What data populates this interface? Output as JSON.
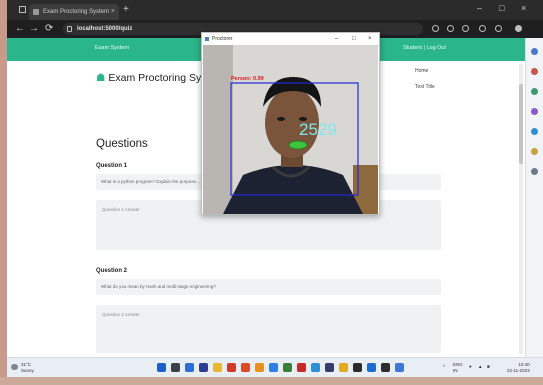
{
  "browser": {
    "tab_title": "Exam Proctoring System",
    "tab_close": "×",
    "new_tab": "+",
    "minimize": "–",
    "maximize": "□",
    "close": "×",
    "back": "←",
    "forward": "→",
    "reload": "⟳",
    "url": "localhost:5000/quiz"
  },
  "navbar": {
    "left": "Exam System",
    "right": "Student | Log Out"
  },
  "page": {
    "brand": "Exam Proctoring Syste",
    "brand_icon": "home-icon",
    "menu": [
      "Home",
      "Test Title"
    ],
    "heading": "Questions",
    "questions": [
      {
        "label": "Question 1",
        "text": "What is a python program? Explain the purpose...",
        "answer_placeholder": "Question 1 Answer"
      },
      {
        "label": "Question 2",
        "text": "What do you mean by Hash and multi-stage engineering?",
        "answer_placeholder": "Question 2 Answer"
      }
    ]
  },
  "video_window": {
    "title": "Proctorer",
    "minimize": "–",
    "maximize": "□",
    "close": "×",
    "overlay_label": "Person: 0.99",
    "counter": "2529"
  },
  "taskbar": {
    "weather_temp": "31°C",
    "weather_desc": "Sunny",
    "lang": "ENG",
    "lang_region": "IN",
    "time": "10:40",
    "date": "22-11-2023"
  },
  "colors": {
    "accent": "#2bb58a",
    "detection_box": "#1f2ad6",
    "overlay_text": "#e01b1b",
    "counter_text": "#7fe7f0",
    "lip_marker": "#3fc43f"
  }
}
